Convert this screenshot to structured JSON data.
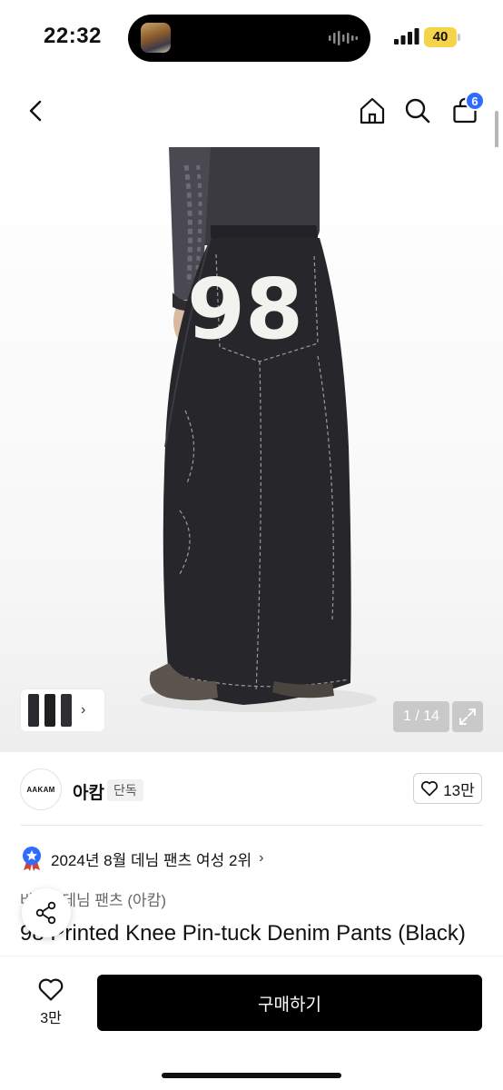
{
  "status_bar": {
    "time": "22:32",
    "battery": "40"
  },
  "header": {
    "cart_count": "6"
  },
  "gallery": {
    "counter": "1 / 14",
    "jersey_number": "98"
  },
  "brand": {
    "logo_text": "AAKAM",
    "name": "아캄",
    "tag": "단독",
    "likes": "13만"
  },
  "ranking": {
    "text": "2024년 8월 데님 팬츠 여성 2위"
  },
  "product": {
    "category": "바지 · 데님 팬츠 (아캄)",
    "title": "98 Printed Knee Pin-tuck Denim Pants (Black)"
  },
  "bottom_bar": {
    "like_count": "3만",
    "buy_label": "구매하기"
  },
  "colors": {
    "accent": "#2f6bff",
    "buy_button": "#000000",
    "battery": "#f6d44a"
  }
}
